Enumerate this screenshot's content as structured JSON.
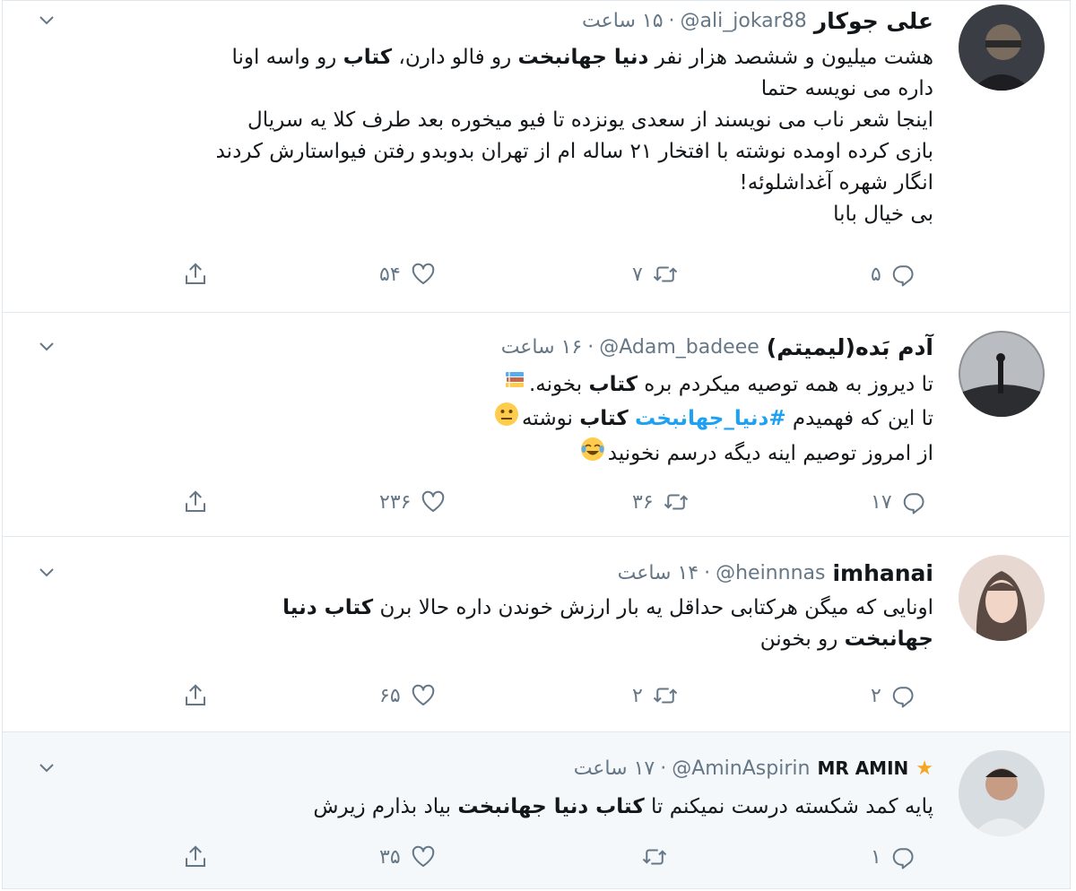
{
  "tweets": [
    {
      "name": "علی جوکار",
      "handle": "@ali_jokar88",
      "time": "۱۵ ساعت",
      "lines": [
        [
          {
            "t": "هشت میلیون و ششصد هزار نفر "
          },
          {
            "t": "دنیا جهانبخت",
            "b": true
          },
          {
            "t": " رو فالو دارن، "
          },
          {
            "t": "کتاب",
            "b": true
          },
          {
            "t": " رو واسه اونا"
          }
        ],
        [
          {
            "t": "داره می نویسه حتما"
          }
        ],
        [
          {
            "t": "اینجا شعر ناب می نویسند از سعدی یونزده تا فیو میخوره بعد طرف کلا یه سریال"
          }
        ],
        [
          {
            "t": "بازی کرده اومده نوشته با افتخار ۲۱ ساله ام از تهران بدوبدو رفتن فیواستارش کردند"
          }
        ],
        [
          {
            "t": "انگار شهره آغداشلوئه!"
          }
        ],
        [
          {
            "t": "بی خیال بابا"
          }
        ]
      ],
      "replies": "۵",
      "retweets": "۷",
      "likes": "۵۴"
    },
    {
      "name": "آدم بَده(لیمیتم)",
      "handle": "@Adam_badeee",
      "time": "۱۶ ساعت",
      "lines": [
        [
          {
            "t": "تا دیروز به همه توصیه میکردم بره "
          },
          {
            "t": "کتاب",
            "b": true
          },
          {
            "t": " بخونه."
          },
          {
            "emoji": "books"
          }
        ],
        [
          {
            "t": "تا این که فهمیدم "
          },
          {
            "t": "#دنیا_جهانبخت",
            "h": true
          },
          {
            "t": " "
          },
          {
            "t": "کتاب",
            "b": true
          },
          {
            "t": " نوشته"
          },
          {
            "emoji": "neutral"
          }
        ],
        [
          {
            "t": "از امروز توصیم اینه دیگه درسم نخونید"
          },
          {
            "emoji": "joy"
          }
        ]
      ],
      "replies": "۱۷",
      "retweets": "۳۶",
      "likes": "۲۳۶"
    },
    {
      "name": "imhanai",
      "handle": "@heinnnas",
      "time": "۱۴ ساعت",
      "lines": [
        [
          {
            "t": "اونایی که میگن هرکتابی حداقل یه بار ارزش خوندن داره حالا برن "
          },
          {
            "t": "کتاب دنیا",
            "b": true
          }
        ],
        [
          {
            "t": "جهانبخت",
            "b": true
          },
          {
            "t": " رو بخونن"
          }
        ]
      ],
      "replies": "۲",
      "retweets": "۲",
      "likes": "۶۵"
    },
    {
      "name": "MR AMIN",
      "handle": "@AminAspirin",
      "time": "۱۷ ساعت",
      "lines": [
        [
          {
            "t": "پایه کمد شکسته درست نمیکنم تا "
          },
          {
            "t": "کتاب دنیا جهانبخت",
            "b": true
          },
          {
            "t": " بیاد بذارم زیرش"
          }
        ]
      ],
      "replies": "۱",
      "retweets": "",
      "likes": "۳۵"
    }
  ],
  "icons": {
    "reply": "reply-icon",
    "retweet": "retweet-icon",
    "like": "heart-icon",
    "share": "share-icon",
    "more": "chevron-down-icon"
  },
  "colors": {
    "text": "#14171a",
    "muted": "#657786",
    "hashtag": "#1da1f2",
    "border": "#e1e8ed"
  }
}
